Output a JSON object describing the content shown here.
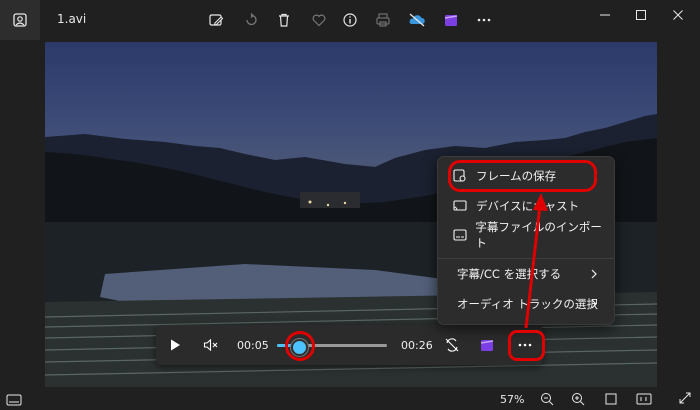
{
  "titlebar": {
    "filename": "1.avi",
    "toolbar_icons": [
      "edit-image-icon",
      "rotate-icon",
      "delete-icon",
      "favorite-icon",
      "info-icon",
      "print-icon",
      "onedrive-icon",
      "clipchamp-icon",
      "more-icon"
    ],
    "window_controls": [
      "minimize-icon",
      "maximize-icon",
      "close-icon"
    ]
  },
  "player": {
    "current_time": "00:05",
    "total_time": "00:26",
    "progress": 0.19
  },
  "menu": {
    "items": [
      {
        "label": "フレームの保存",
        "icon": "save-frame-icon"
      },
      {
        "label": "デバイスにキャスト",
        "icon": "cast-icon"
      },
      {
        "label": "字幕ファイルのインポート",
        "icon": "subtitle-icon"
      },
      {
        "label": "字幕/CC を選択する",
        "icon": "chevron-right-icon"
      },
      {
        "label": "オーディオ トラックの選択",
        "icon": "chevron-right-icon"
      }
    ]
  },
  "status": {
    "zoom": "57%"
  },
  "colors": {
    "accent": "#4cc2ff",
    "highlight": "#e00000",
    "background": "#202020",
    "menu": "#2c2c2c"
  }
}
